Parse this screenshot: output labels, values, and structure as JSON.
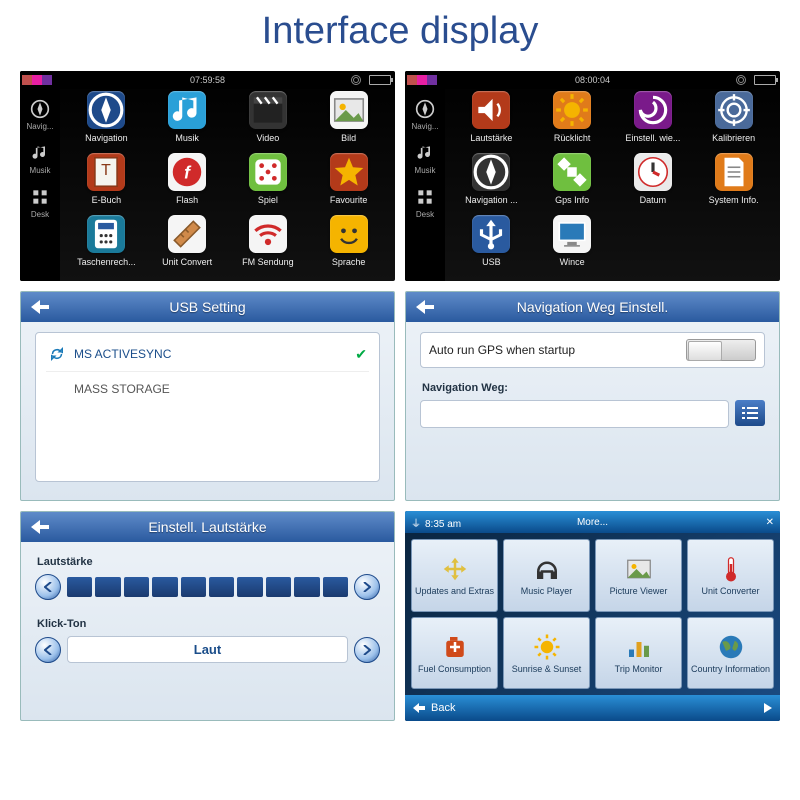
{
  "page_title": "Interface display",
  "launcher_left": {
    "time": "07:59:58",
    "status_colors": [
      "#c0504d",
      "#e81fa3",
      "#7030a0"
    ],
    "sidebar": [
      {
        "label": "Navig...",
        "icon": "compass"
      },
      {
        "label": "Musik",
        "icon": "music-note"
      },
      {
        "label": "Desk",
        "icon": "grid"
      }
    ],
    "apps": [
      {
        "label": "Navigation",
        "color": "#1e4a8a",
        "icon": "compass"
      },
      {
        "label": "Musik",
        "color": "#2aa0d8",
        "icon": "music-note"
      },
      {
        "label": "Video",
        "color": "#333333",
        "icon": "clapper"
      },
      {
        "label": "Bild",
        "color": "#f5f5f5",
        "icon": "image"
      },
      {
        "label": "E-Buch",
        "color": "#b33a1a",
        "icon": "book"
      },
      {
        "label": "Flash",
        "color": "#f5f5f5",
        "icon": "flash"
      },
      {
        "label": "Spiel",
        "color": "#6fbf3f",
        "icon": "dice"
      },
      {
        "label": "Favourite",
        "color": "#b33a1a",
        "icon": "star"
      },
      {
        "label": "Taschenrech...",
        "color": "#1a7a9a",
        "icon": "calc"
      },
      {
        "label": "Unit Convert",
        "color": "#f5f5f5",
        "icon": "ruler"
      },
      {
        "label": "FM Sendung",
        "color": "#f5f5f5",
        "icon": "wifi"
      },
      {
        "label": "Sprache",
        "color": "#f5b400",
        "icon": "smile"
      }
    ]
  },
  "launcher_right": {
    "time": "08:00:04",
    "status_colors": [
      "#c0504d",
      "#e81fa3",
      "#7030a0"
    ],
    "sidebar": [
      {
        "label": "Navig...",
        "icon": "compass"
      },
      {
        "label": "Musik",
        "icon": "music-note"
      },
      {
        "label": "Desk",
        "icon": "grid"
      }
    ],
    "apps": [
      {
        "label": "Lautstärke",
        "color": "#b33a1a",
        "icon": "speaker"
      },
      {
        "label": "Rücklicht",
        "color": "#e07b1a",
        "icon": "sun"
      },
      {
        "label": "Einstell. wie...",
        "color": "#7a1a8a",
        "icon": "swirl"
      },
      {
        "label": "Kalibrieren",
        "color": "#4a6a9a",
        "icon": "target"
      },
      {
        "label": "Navigation ...",
        "color": "#333333",
        "icon": "compass"
      },
      {
        "label": "Gps Info",
        "color": "#6fbf3f",
        "icon": "satellite"
      },
      {
        "label": "Datum",
        "color": "#eaeaea",
        "icon": "clock"
      },
      {
        "label": "System Info.",
        "color": "#e07b1a",
        "icon": "doc"
      },
      {
        "label": "USB",
        "color": "#2a5a9f",
        "icon": "usb"
      },
      {
        "label": "Wince",
        "color": "#f5f5f5",
        "icon": "monitor"
      }
    ]
  },
  "usb_setting": {
    "title": "USB Setting",
    "options": [
      {
        "label": "MS ACTIVESYNC",
        "icon": "sync",
        "selected": true
      },
      {
        "label": "MASS STORAGE",
        "icon": "usb",
        "selected": false
      }
    ]
  },
  "nav_setting": {
    "title": "Navigation Weg Einstell.",
    "autorun_label": "Auto run GPS when startup",
    "path_label": "Navigation Weg:"
  },
  "volume_setting": {
    "title": "Einstell. Lautstärke",
    "slider_label": "Lautstärke",
    "level": 10,
    "max": 10,
    "click_label": "Klick-Ton",
    "click_value": "Laut"
  },
  "more_panel": {
    "time": "8:35 am",
    "title": "More...",
    "items": [
      {
        "label": "Updates and Extras",
        "icon": "crossarrows",
        "color": "#e0c040"
      },
      {
        "label": "Music Player",
        "icon": "headphones",
        "color": "#333"
      },
      {
        "label": "Picture Viewer",
        "icon": "image",
        "color": "#8a5a3a"
      },
      {
        "label": "Unit Converter",
        "icon": "thermo",
        "color": "#e0c040"
      },
      {
        "label": "Fuel Consumption",
        "icon": "fuelcan",
        "color": "#d04a1a"
      },
      {
        "label": "Sunrise & Sunset",
        "icon": "sun",
        "color": "#e0a020"
      },
      {
        "label": "Trip Monitor",
        "icon": "barchart",
        "color": "#2a7ab8"
      },
      {
        "label": "Country Information",
        "icon": "globe",
        "color": "#2a7a4a"
      }
    ],
    "back_label": "Back"
  }
}
